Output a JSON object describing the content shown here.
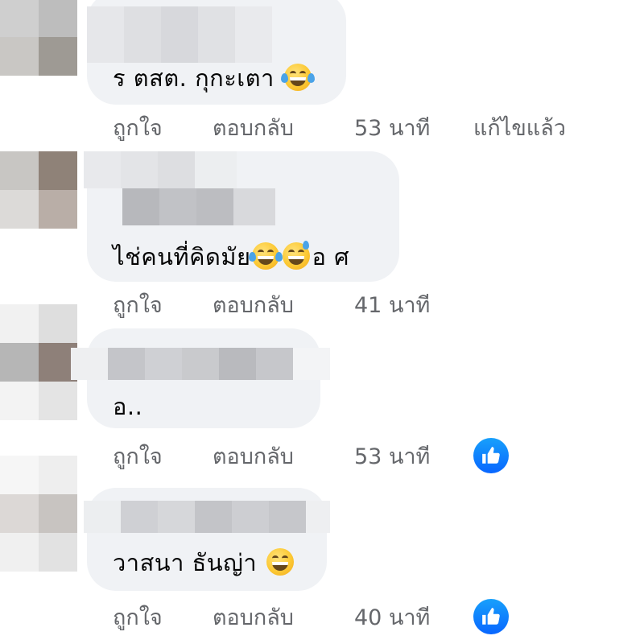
{
  "comments": [
    {
      "text": "ร ตสต. กุกะเตา",
      "emojis": [
        "tears-of-joy-emoji"
      ],
      "actions": {
        "like": "ถูกใจ",
        "reply": "ตอบกลับ",
        "time": "53 นาที",
        "edited": "แก้ไขแล้ว"
      },
      "has_reaction": false
    },
    {
      "text": "ไช่คนที่คิดมัย",
      "text_suffix": "อ ศ",
      "emojis": [
        "tears-of-joy-emoji",
        "grinning-sweat-emoji"
      ],
      "actions": {
        "like": "ถูกใจ",
        "reply": "ตอบกลับ",
        "time": "41 นาที"
      },
      "has_reaction": false
    },
    {
      "text": "อ..",
      "emojis": [],
      "actions": {
        "like": "ถูกใจ",
        "reply": "ตอบกลับ",
        "time": "53 นาที"
      },
      "has_reaction": true,
      "reaction_icon": "thumbs-up-icon"
    },
    {
      "text": "วาสนา ธันญ่า",
      "emojis": [
        "beaming-grin-emoji"
      ],
      "actions": {
        "like": "ถูกใจ",
        "reply": "ตอบกลับ",
        "time": "40 นาที"
      },
      "has_reaction": true,
      "reaction_icon": "thumbs-up-icon"
    }
  ],
  "colors": {
    "bubble": "#f0f2f5",
    "text": "#050505",
    "meta": "#65676b",
    "like_blue": "#0866ff"
  }
}
